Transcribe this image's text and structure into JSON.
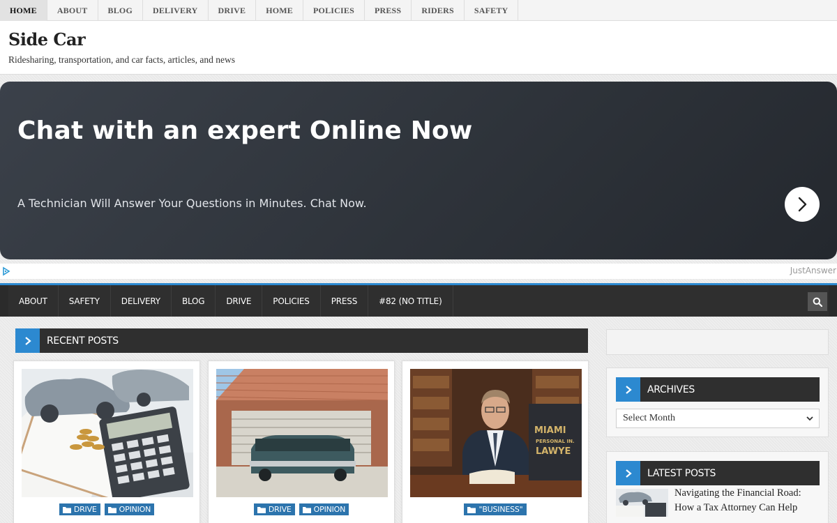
{
  "top_menu": [
    "HOME",
    "ABOUT",
    "BLOG",
    "DELIVERY",
    "DRIVE",
    "HOME",
    "POLICIES",
    "PRESS",
    "RIDERS",
    "SAFETY"
  ],
  "site": {
    "title": "Side Car",
    "description": "Ridesharing, transportation, and car facts, articles, and news"
  },
  "ad": {
    "headline": "Chat with an expert Online Now",
    "subtext": "A Technician Will Answer Your Questions in Minutes. Chat Now.",
    "brand": "JustAnswer",
    "colors": {
      "background": "#2e333a"
    }
  },
  "main_menu": [
    "ABOUT",
    "SAFETY",
    "DELIVERY",
    "BLOG",
    "DRIVE",
    "POLICIES",
    "PRESS",
    "#82 (NO TITLE)"
  ],
  "recent_posts": {
    "heading": "RECENT POSTS",
    "cards": [
      {
        "image": "car-model-calculator-coins",
        "categories": [
          "DRIVE",
          "OPINION"
        ]
      },
      {
        "image": "vintage-car-garage",
        "categories": [
          "DRIVE",
          "OPINION"
        ]
      },
      {
        "image": "lawyer-at-desk",
        "categories": [
          "\"BUSINESS\""
        ]
      }
    ]
  },
  "sidebar": {
    "archives": {
      "heading": "ARCHIVES",
      "select_value": "Select Month"
    },
    "latest_posts": {
      "heading": "LATEST POSTS",
      "first_post": {
        "image": "car-model-calculator",
        "title": "Navigating the Financial Road: How a Tax Attorney Can Help"
      }
    }
  },
  "colors": {
    "accent": "#2c89d0",
    "dark_bar": "#2f2f2f",
    "category_badge": "#2c74ad"
  },
  "icons": [
    "chevron-right-icon",
    "search-icon",
    "folder-icon",
    "adchoices-icon",
    "caret-down-icon"
  ]
}
